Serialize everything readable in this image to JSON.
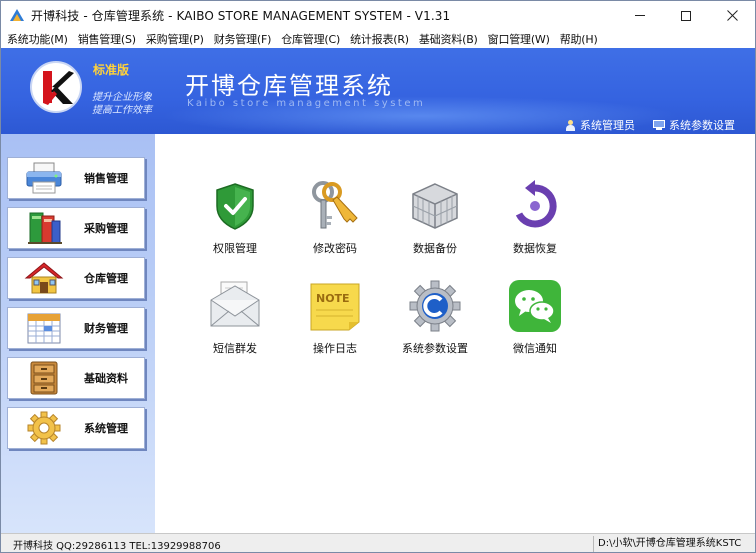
{
  "window": {
    "title": "开博科技 - 仓库管理系统 - KAIBO STORE MANAGEMENT SYSTEM - V1.31",
    "controls": [
      "minimize",
      "maximize",
      "close"
    ]
  },
  "menu": [
    "系统功能(M)",
    "销售管理(S)",
    "采购管理(P)",
    "财务管理(F)",
    "仓库管理(C)",
    "统计报表(R)",
    "基础资料(B)",
    "窗口管理(W)",
    "帮助(H)"
  ],
  "header": {
    "edition": "标准版",
    "slogan_line1": "提升企业形象",
    "slogan_line2": "提高工作效率",
    "system_title": "开博仓库管理系统",
    "system_subtitle": "Kaibo store management system",
    "user_link": "系统管理员",
    "settings_link": "系统参数设置"
  },
  "sidebar": {
    "items": [
      {
        "label": "销售管理",
        "icon": "printer-icon"
      },
      {
        "label": "采购管理",
        "icon": "books-icon"
      },
      {
        "label": "仓库管理",
        "icon": "house-icon"
      },
      {
        "label": "财务管理",
        "icon": "calendar-icon"
      },
      {
        "label": "基础资料",
        "icon": "cabinet-icon"
      },
      {
        "label": "系统管理",
        "icon": "gear-icon"
      }
    ]
  },
  "tiles": [
    {
      "label": "权限管理",
      "icon": "shield-check-icon"
    },
    {
      "label": "修改密码",
      "icon": "keys-icon"
    },
    {
      "label": "数据备份",
      "icon": "cube-cage-icon"
    },
    {
      "label": "数据恢复",
      "icon": "restore-icon"
    },
    {
      "label": "短信群发",
      "icon": "envelope-icon"
    },
    {
      "label": "操作日志",
      "icon": "note-icon"
    },
    {
      "label": "系统参数设置",
      "icon": "settings-gear-icon"
    },
    {
      "label": "微信通知",
      "icon": "wechat-icon"
    }
  ],
  "status": {
    "left": "开博科技 QQ:29286113 TEL:13929988706",
    "right": "D:\\小软\\开博仓库管理系统KSTC"
  },
  "colors": {
    "banner": "#3563e0",
    "edition": "#ffd23a",
    "sidebar_top": "#a9c0f4",
    "sidebar_bottom": "#d7e4fb"
  }
}
